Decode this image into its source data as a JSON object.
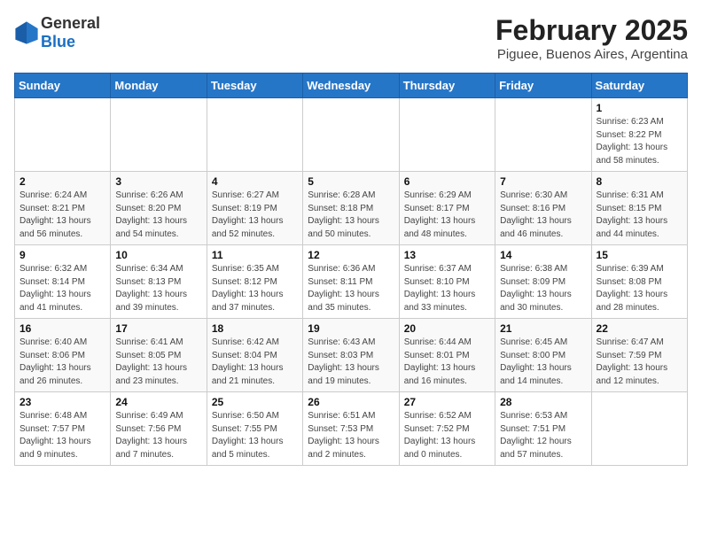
{
  "header": {
    "logo_general": "General",
    "logo_blue": "Blue",
    "title": "February 2025",
    "subtitle": "Piguee, Buenos Aires, Argentina"
  },
  "calendar": {
    "weekdays": [
      "Sunday",
      "Monday",
      "Tuesday",
      "Wednesday",
      "Thursday",
      "Friday",
      "Saturday"
    ],
    "weeks": [
      [
        {
          "day": "",
          "info": ""
        },
        {
          "day": "",
          "info": ""
        },
        {
          "day": "",
          "info": ""
        },
        {
          "day": "",
          "info": ""
        },
        {
          "day": "",
          "info": ""
        },
        {
          "day": "",
          "info": ""
        },
        {
          "day": "1",
          "info": "Sunrise: 6:23 AM\nSunset: 8:22 PM\nDaylight: 13 hours\nand 58 minutes."
        }
      ],
      [
        {
          "day": "2",
          "info": "Sunrise: 6:24 AM\nSunset: 8:21 PM\nDaylight: 13 hours\nand 56 minutes."
        },
        {
          "day": "3",
          "info": "Sunrise: 6:26 AM\nSunset: 8:20 PM\nDaylight: 13 hours\nand 54 minutes."
        },
        {
          "day": "4",
          "info": "Sunrise: 6:27 AM\nSunset: 8:19 PM\nDaylight: 13 hours\nand 52 minutes."
        },
        {
          "day": "5",
          "info": "Sunrise: 6:28 AM\nSunset: 8:18 PM\nDaylight: 13 hours\nand 50 minutes."
        },
        {
          "day": "6",
          "info": "Sunrise: 6:29 AM\nSunset: 8:17 PM\nDaylight: 13 hours\nand 48 minutes."
        },
        {
          "day": "7",
          "info": "Sunrise: 6:30 AM\nSunset: 8:16 PM\nDaylight: 13 hours\nand 46 minutes."
        },
        {
          "day": "8",
          "info": "Sunrise: 6:31 AM\nSunset: 8:15 PM\nDaylight: 13 hours\nand 44 minutes."
        }
      ],
      [
        {
          "day": "9",
          "info": "Sunrise: 6:32 AM\nSunset: 8:14 PM\nDaylight: 13 hours\nand 41 minutes."
        },
        {
          "day": "10",
          "info": "Sunrise: 6:34 AM\nSunset: 8:13 PM\nDaylight: 13 hours\nand 39 minutes."
        },
        {
          "day": "11",
          "info": "Sunrise: 6:35 AM\nSunset: 8:12 PM\nDaylight: 13 hours\nand 37 minutes."
        },
        {
          "day": "12",
          "info": "Sunrise: 6:36 AM\nSunset: 8:11 PM\nDaylight: 13 hours\nand 35 minutes."
        },
        {
          "day": "13",
          "info": "Sunrise: 6:37 AM\nSunset: 8:10 PM\nDaylight: 13 hours\nand 33 minutes."
        },
        {
          "day": "14",
          "info": "Sunrise: 6:38 AM\nSunset: 8:09 PM\nDaylight: 13 hours\nand 30 minutes."
        },
        {
          "day": "15",
          "info": "Sunrise: 6:39 AM\nSunset: 8:08 PM\nDaylight: 13 hours\nand 28 minutes."
        }
      ],
      [
        {
          "day": "16",
          "info": "Sunrise: 6:40 AM\nSunset: 8:06 PM\nDaylight: 13 hours\nand 26 minutes."
        },
        {
          "day": "17",
          "info": "Sunrise: 6:41 AM\nSunset: 8:05 PM\nDaylight: 13 hours\nand 23 minutes."
        },
        {
          "day": "18",
          "info": "Sunrise: 6:42 AM\nSunset: 8:04 PM\nDaylight: 13 hours\nand 21 minutes."
        },
        {
          "day": "19",
          "info": "Sunrise: 6:43 AM\nSunset: 8:03 PM\nDaylight: 13 hours\nand 19 minutes."
        },
        {
          "day": "20",
          "info": "Sunrise: 6:44 AM\nSunset: 8:01 PM\nDaylight: 13 hours\nand 16 minutes."
        },
        {
          "day": "21",
          "info": "Sunrise: 6:45 AM\nSunset: 8:00 PM\nDaylight: 13 hours\nand 14 minutes."
        },
        {
          "day": "22",
          "info": "Sunrise: 6:47 AM\nSunset: 7:59 PM\nDaylight: 13 hours\nand 12 minutes."
        }
      ],
      [
        {
          "day": "23",
          "info": "Sunrise: 6:48 AM\nSunset: 7:57 PM\nDaylight: 13 hours\nand 9 minutes."
        },
        {
          "day": "24",
          "info": "Sunrise: 6:49 AM\nSunset: 7:56 PM\nDaylight: 13 hours\nand 7 minutes."
        },
        {
          "day": "25",
          "info": "Sunrise: 6:50 AM\nSunset: 7:55 PM\nDaylight: 13 hours\nand 5 minutes."
        },
        {
          "day": "26",
          "info": "Sunrise: 6:51 AM\nSunset: 7:53 PM\nDaylight: 13 hours\nand 2 minutes."
        },
        {
          "day": "27",
          "info": "Sunrise: 6:52 AM\nSunset: 7:52 PM\nDaylight: 13 hours\nand 0 minutes."
        },
        {
          "day": "28",
          "info": "Sunrise: 6:53 AM\nSunset: 7:51 PM\nDaylight: 12 hours\nand 57 minutes."
        },
        {
          "day": "",
          "info": ""
        }
      ]
    ]
  }
}
